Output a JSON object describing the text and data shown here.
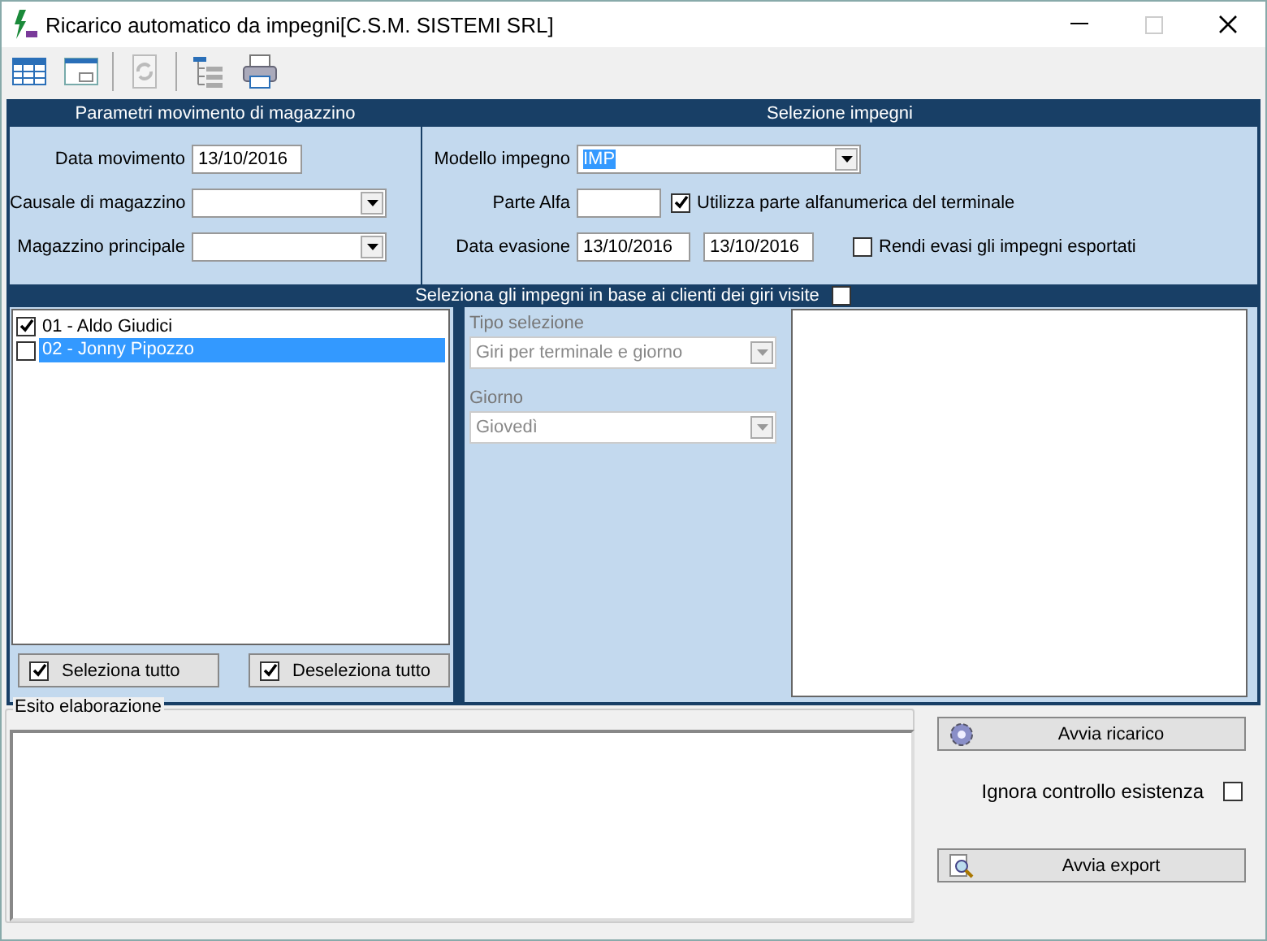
{
  "window": {
    "title": "Ricarico automatico da impegni[C.S.M. SISTEMI SRL]",
    "maximize_disabled": true
  },
  "toolbar": [
    {
      "kind": "table",
      "disabled": false
    },
    {
      "kind": "form",
      "disabled": false
    },
    {
      "kind": "refresh",
      "disabled": true
    },
    {
      "kind": "tree",
      "disabled": false
    },
    {
      "kind": "printer",
      "disabled": false
    }
  ],
  "movement_params": {
    "header": "Parametri movimento di magazzino",
    "fields": [
      {
        "label": "Data movimento",
        "kind": "text",
        "value": "13/10/2016"
      },
      {
        "label": "Causale di magazzino",
        "kind": "dropdown"
      },
      {
        "label": "Magazzino principale",
        "kind": "dropdown"
      }
    ]
  },
  "selection": {
    "header": "Selezione impegni",
    "model": {
      "label": "Modello impegno",
      "value": "IMP",
      "text_selected": true
    },
    "alpha_part": {
      "label": "Parte Alfa"
    },
    "use_alpha": {
      "label": "Utilizza parte alfanumerica del terminale",
      "checked": true
    },
    "due_date": {
      "label": "Data evasione",
      "from": "13/10/2016",
      "to": "13/10/2016"
    },
    "mark_exported": {
      "label": "Rendi evasi gli impegni esportati",
      "checked": false
    }
  },
  "routes": {
    "header": "Seleziona gli impegni in base ai clienti dei giri visite",
    "checked": false,
    "clients": [
      {
        "label": "01 - Aldo Giudici",
        "checked": true,
        "selected": false
      },
      {
        "label": "02 - Jonny Pipozzo",
        "checked": false,
        "selected": true
      }
    ],
    "buttons": [
      {
        "label": "Seleziona tutto",
        "checked": true
      },
      {
        "label": "Deseleziona tutto",
        "checked": true
      }
    ],
    "selection_type": {
      "label": "Tipo selezione",
      "value": "Giri per terminale e giorno",
      "disabled": true
    },
    "day": {
      "label": "Giorno",
      "value": "Giovedì",
      "disabled": true
    }
  },
  "output": {
    "label": "Esito elaborazione"
  },
  "actions": [
    {
      "label": "Avvia ricarico",
      "kind": "gear"
    },
    {
      "label": "Avvia export",
      "kind": "magnifier"
    }
  ],
  "ignore_check": {
    "label": "Ignora controllo esistenza",
    "checked": false
  }
}
